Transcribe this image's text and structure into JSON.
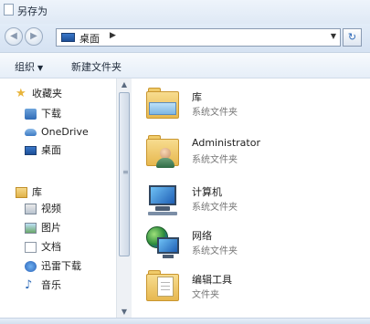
{
  "window": {
    "title": "另存为"
  },
  "address": {
    "location": "桌面"
  },
  "toolbar": {
    "organize_label": "组织",
    "new_folder_label": "新建文件夹"
  },
  "sidebar": {
    "favorites": {
      "label": "收藏夹",
      "items": [
        {
          "label": "下载",
          "icon": "download-icon"
        },
        {
          "label": "OneDrive",
          "icon": "cloud-icon"
        },
        {
          "label": "桌面",
          "icon": "desktop-icon"
        }
      ]
    },
    "libraries": {
      "label": "库",
      "items": [
        {
          "label": "视频",
          "icon": "video-icon"
        },
        {
          "label": "图片",
          "icon": "picture-icon"
        },
        {
          "label": "文档",
          "icon": "document-icon"
        },
        {
          "label": "迅雷下载",
          "icon": "thunder-icon"
        },
        {
          "label": "音乐",
          "icon": "music-icon"
        }
      ]
    }
  },
  "content": {
    "items": [
      {
        "name": "库",
        "type": "系统文件夹",
        "icon": "library-folder-icon"
      },
      {
        "name": "Administrator",
        "type": "系统文件夹",
        "icon": "user-folder-icon"
      },
      {
        "name": "计算机",
        "type": "系统文件夹",
        "icon": "computer-icon"
      },
      {
        "name": "网络",
        "type": "系统文件夹",
        "icon": "network-icon"
      },
      {
        "name": "编辑工具",
        "type": "文件夹",
        "icon": "folder-icon"
      }
    ]
  }
}
